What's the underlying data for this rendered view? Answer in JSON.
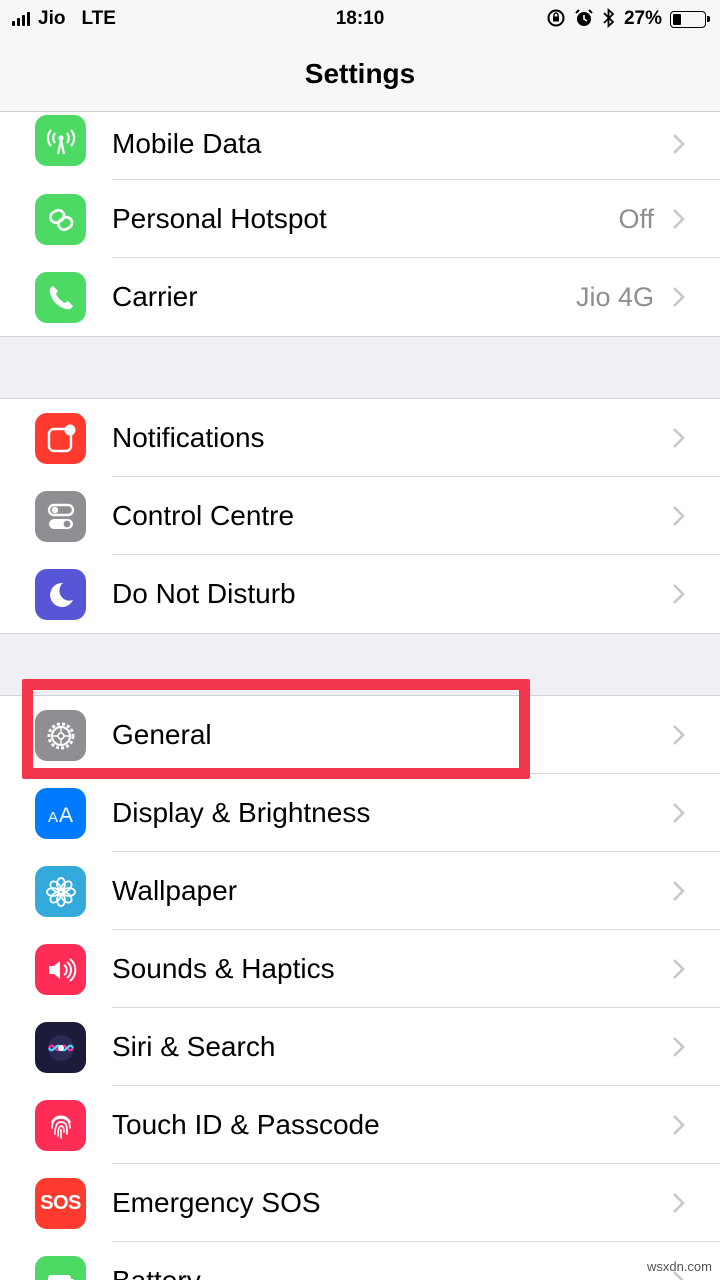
{
  "status_bar": {
    "carrier": "Jio",
    "network": "LTE",
    "time": "18:10",
    "battery": "27%",
    "battery_fraction": 0.27
  },
  "nav": {
    "title": "Settings"
  },
  "groups": [
    {
      "rows": [
        {
          "label": "Mobile Data",
          "value": "",
          "icon": "antenna-icon",
          "color": "#4cd964"
        },
        {
          "label": "Personal Hotspot",
          "value": "Off",
          "icon": "hotspot-link-icon",
          "color": "#4cd964"
        },
        {
          "label": "Carrier",
          "value": "Jio 4G",
          "icon": "phone-icon",
          "color": "#4cd964"
        }
      ]
    },
    {
      "rows": [
        {
          "label": "Notifications",
          "value": "",
          "icon": "notifications-icon",
          "color": "#ff3b30"
        },
        {
          "label": "Control Centre",
          "value": "",
          "icon": "toggles-icon",
          "color": "#8e8e93"
        },
        {
          "label": "Do Not Disturb",
          "value": "",
          "icon": "moon-icon",
          "color": "#5856d6"
        }
      ]
    },
    {
      "rows": [
        {
          "label": "General",
          "value": "",
          "icon": "gear-icon",
          "color": "#8e8e93"
        },
        {
          "label": "Display & Brightness",
          "value": "",
          "icon": "text-size-icon",
          "color": "#007aff"
        },
        {
          "label": "Wallpaper",
          "value": "",
          "icon": "flower-icon",
          "color": "#34aadc"
        },
        {
          "label": "Sounds & Haptics",
          "value": "",
          "icon": "speaker-icon",
          "color": "#ff2d55"
        },
        {
          "label": "Siri & Search",
          "value": "",
          "icon": "siri-icon",
          "color": "#1c1c3a"
        },
        {
          "label": "Touch ID & Passcode",
          "value": "",
          "icon": "fingerprint-icon",
          "color": "#ff2d55"
        },
        {
          "label": "Emergency SOS",
          "value": "",
          "icon": "sos-icon",
          "color": "#ff3b30",
          "icon_text": "SOS"
        },
        {
          "label": "Battery",
          "value": "",
          "icon": "battery-icon",
          "color": "#4cd964"
        }
      ]
    }
  ],
  "highlight_color": "#f4364c",
  "watermark": "wsxdn.com"
}
